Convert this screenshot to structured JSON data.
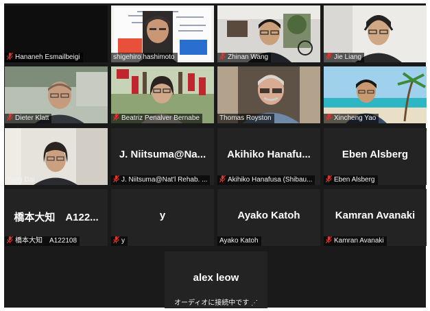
{
  "participants": [
    {
      "name": "Hananeh Esmailbeigi",
      "muted": true,
      "video": false
    },
    {
      "name": "shigehiro hashimoto",
      "muted": false,
      "video": true
    },
    {
      "name": "Zhinan Wang",
      "muted": true,
      "video": true
    },
    {
      "name": "Jie Liang",
      "muted": true,
      "video": true
    },
    {
      "name": "Dieter Klatt",
      "muted": true,
      "video": true
    },
    {
      "name": "Beatriz Penalver Bernabe",
      "muted": true,
      "video": true
    },
    {
      "name": "Thomas Royston",
      "muted": false,
      "video": true,
      "active_speaker": true
    },
    {
      "name": "Xincheng Yao",
      "muted": true,
      "video": true
    },
    {
      "name": "Yang Dai",
      "muted": false,
      "video": true
    },
    {
      "display": "J. Niitsuma@Na...",
      "name": "J. Niitsuma@Nat'l Rehab. ...",
      "muted": true,
      "video": false
    },
    {
      "display": "Akihiko  Hanafu...",
      "name": "Akihiko Hanafusa (Shibau...",
      "muted": true,
      "video": false
    },
    {
      "display": "Eben Alsberg",
      "name": "Eben Alsberg",
      "muted": true,
      "video": false
    },
    {
      "display": "橋本大知　A122...",
      "name": "橋本大知　A122108",
      "muted": true,
      "video": false
    },
    {
      "display": "y",
      "name": "y",
      "muted": true,
      "video": false
    },
    {
      "display": "Ayako Katoh",
      "name": "Ayako Katoh",
      "muted": false,
      "video": false
    },
    {
      "display": "Kamran Avanaki",
      "name": "Kamran Avanaki",
      "muted": true,
      "video": false
    },
    {
      "display": "alex leow",
      "status": "オーディオに接続中です ⋰",
      "video": false
    }
  ],
  "colors": {
    "active_speaker": "#d7e25a",
    "muted_icon": "#e0342c",
    "tile_bg": "#232323",
    "stage_bg": "#1a1a1a"
  }
}
